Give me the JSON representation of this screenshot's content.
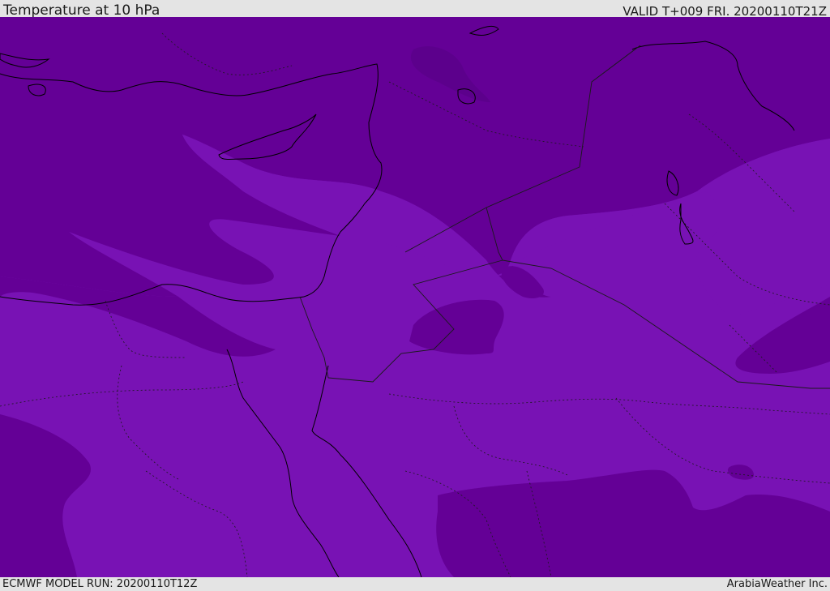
{
  "header": {
    "title": "Temperature at 10 hPa",
    "valid": "VALID T+009 FRI. 20200110T21Z"
  },
  "footer": {
    "model_run": "ECMWF MODEL RUN: 20200110T12Z",
    "credit": "ArabiaWeather Inc."
  },
  "map": {
    "colors": {
      "cold_band": "#640096",
      "warm_band": "#7812b4",
      "darkest_band": "#5c008c",
      "coastline": "#000000",
      "border": "#1a1a1a"
    }
  }
}
